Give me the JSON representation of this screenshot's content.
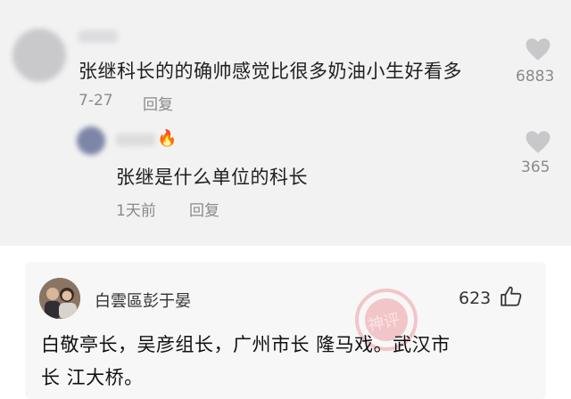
{
  "top_comment": {
    "text": "张继科长的的确帅感觉比很多奶油小生好看多",
    "date": "7-27",
    "reply_label": "回复",
    "like_count": "6883"
  },
  "reply_comment": {
    "name_emoji": "🔥",
    "text": "张继是什么单位的科长",
    "date": "1天前",
    "reply_label": "回复",
    "like_count": "365"
  },
  "bottom_comment": {
    "username": "白雲區彭于晏",
    "like_count": "623",
    "text_line1": "白敬亭长，吴彦组长，广州市长 隆马戏。武汉市",
    "text_line2": "长 江大桥。",
    "watermark_text": "神评"
  },
  "colors": {
    "panel_gray": "#f2f2f3",
    "bottom_panel": "#f7f7f8",
    "meta_gray": "#8a8a8a",
    "heart_gray": "#c8c8ca",
    "watermark_red": "#e8474f"
  }
}
